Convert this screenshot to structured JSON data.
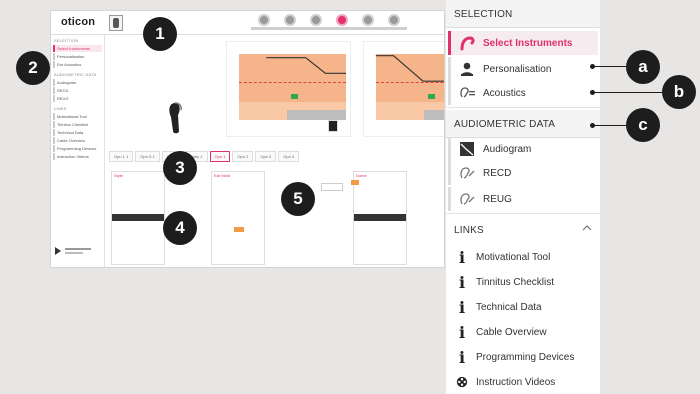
{
  "app": {
    "logo": "oticon",
    "sidebar": {
      "section1": "SELECTION",
      "items1": [
        "Select Instruments",
        "Personalisation",
        "Ear Acoustics"
      ],
      "section2": "AUDIOMETRIC DATA",
      "items2": [
        "Audiogram",
        "RECD",
        "REUG"
      ],
      "section3": "LINKS",
      "items3": [
        "Motivational Tool",
        "Tinnitus Checklist",
        "Technical Data",
        "Cable Overview",
        "Programming Devices",
        "Instruction Videos"
      ]
    },
    "tabs": [
      "Opn 1 1",
      "Opn S 1",
      "Opn 2",
      "Ruby 1",
      "Opn 1",
      "Opn 2",
      "Opn 3",
      "Opn 4"
    ],
    "list_headers": [
      "Style",
      "Ear Mold",
      "Dome"
    ]
  },
  "panel": {
    "selection_header": "SELECTION",
    "select_instruments": "Select Instruments",
    "personalisation": "Personalisation",
    "acoustics": "Acoustics",
    "audiometric_header": "AUDIOMETRIC DATA",
    "audiogram": "Audiogram",
    "recd": "RECD",
    "reug": "REUG",
    "links_header": "LINKS",
    "links": {
      "motivational": "Motivational Tool",
      "tinnitus": "Tinnitus Checklist",
      "technical": "Technical Data",
      "cable": "Cable Overview",
      "programming": "Programming Devices",
      "videos": "Instruction Videos"
    }
  },
  "badges": {
    "one": "1",
    "two": "2",
    "three": "3",
    "four": "4",
    "five": "5",
    "a": "a",
    "b": "b",
    "c": "c"
  },
  "colors": {
    "accent": "#e0306e",
    "badge": "#1d1d1d",
    "chart_fill": "#f6b48a"
  },
  "icons": {
    "select_instruments": "hearing-aid-hook-icon",
    "personalisation": "person-icon",
    "acoustics": "ear-acoustics-icon",
    "audiogram": "audiogram-icon",
    "recd": "ear-recd-icon",
    "reug": "ear-reug-icon",
    "info": "info-icon",
    "videos": "film-reel-icon",
    "links_toggle": "chevron-up-icon"
  }
}
